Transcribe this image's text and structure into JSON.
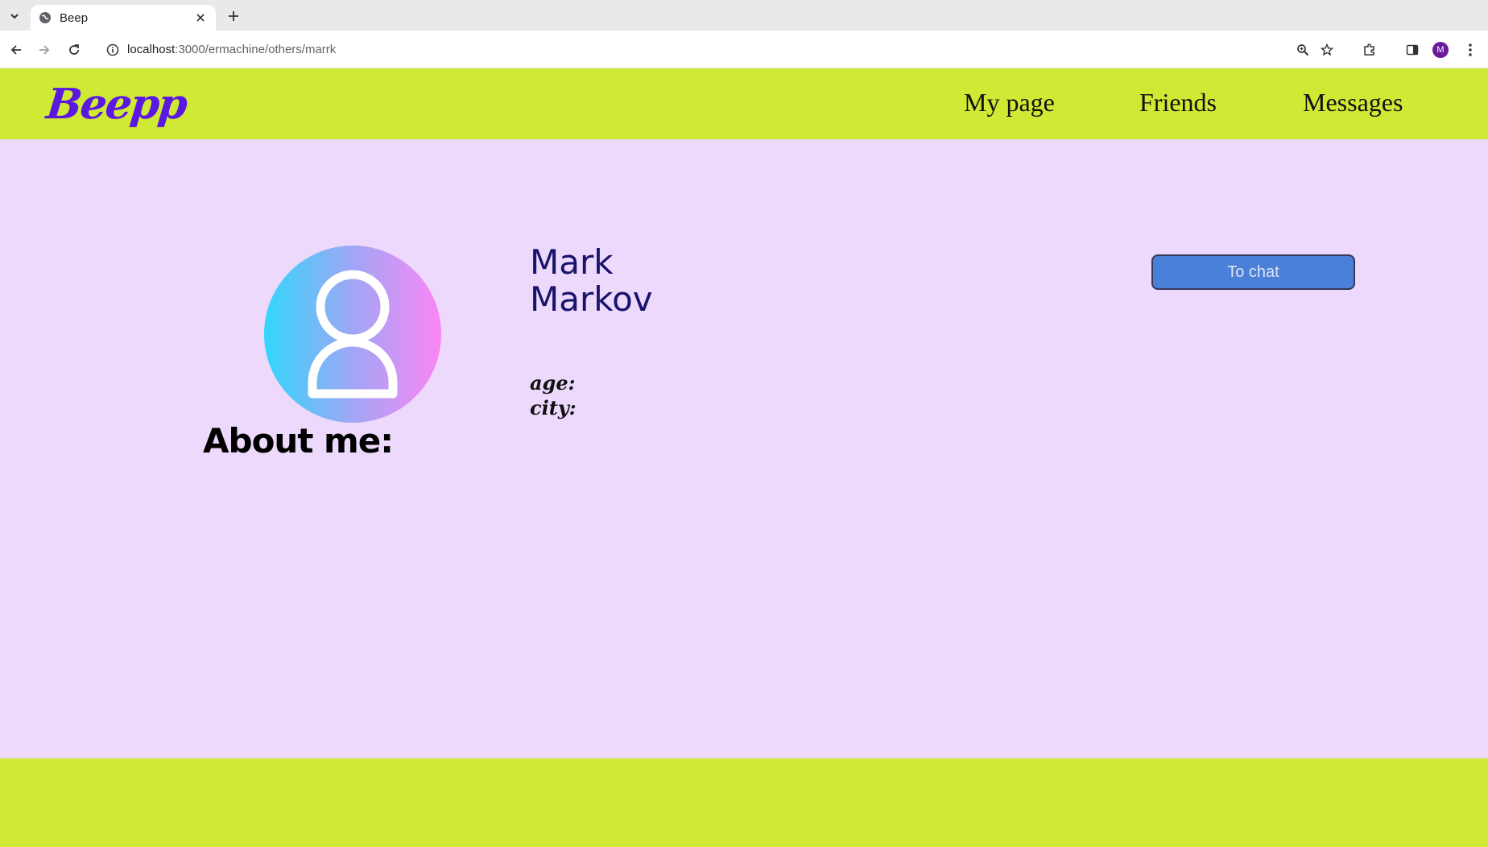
{
  "browser": {
    "tab_title": "Beep",
    "url_host": "localhost",
    "url_path": ":3000/ermachine/others/marrk",
    "profile_initial": "M"
  },
  "site": {
    "logo": "Beepp",
    "nav": [
      {
        "label": "My page"
      },
      {
        "label": "Friends"
      },
      {
        "label": "Messages"
      }
    ]
  },
  "profile": {
    "first_name": "Mark",
    "last_name": "Markov",
    "age_label": "age:",
    "city_label": "city:",
    "chat_button": "To chat",
    "about_heading": "About me:"
  },
  "colors": {
    "header_bg": "#d0e935",
    "content_bg": "#ecd9fb",
    "logo": "#5a18e0",
    "name": "#18136b",
    "button_bg": "#4a80d8"
  }
}
